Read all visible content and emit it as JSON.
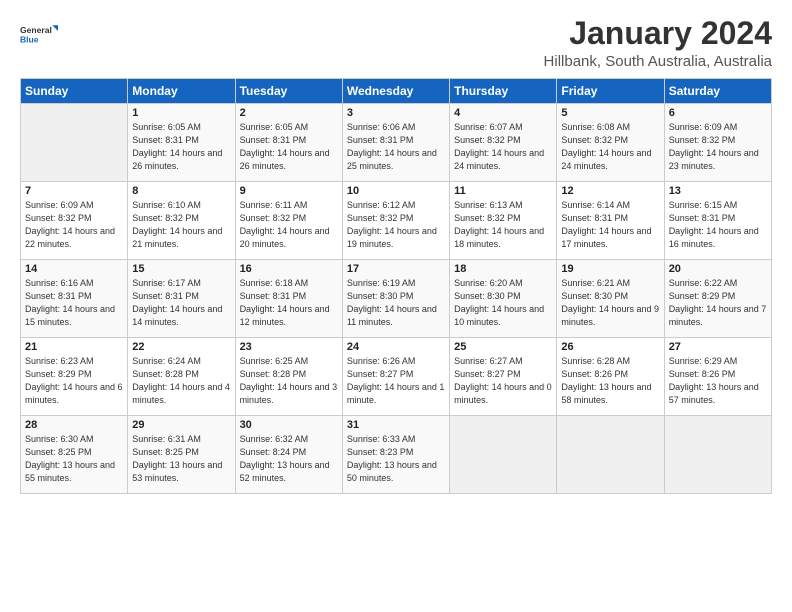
{
  "logo": {
    "line1": "General",
    "line2": "Blue"
  },
  "calendar": {
    "title": "January 2024",
    "subtitle": "Hillbank, South Australia, Australia"
  },
  "headers": [
    "Sunday",
    "Monday",
    "Tuesday",
    "Wednesday",
    "Thursday",
    "Friday",
    "Saturday"
  ],
  "weeks": [
    [
      {
        "day": "",
        "sunrise": "",
        "sunset": "",
        "daylight": ""
      },
      {
        "day": "1",
        "sunrise": "Sunrise: 6:05 AM",
        "sunset": "Sunset: 8:31 PM",
        "daylight": "Daylight: 14 hours and 26 minutes."
      },
      {
        "day": "2",
        "sunrise": "Sunrise: 6:05 AM",
        "sunset": "Sunset: 8:31 PM",
        "daylight": "Daylight: 14 hours and 26 minutes."
      },
      {
        "day": "3",
        "sunrise": "Sunrise: 6:06 AM",
        "sunset": "Sunset: 8:31 PM",
        "daylight": "Daylight: 14 hours and 25 minutes."
      },
      {
        "day": "4",
        "sunrise": "Sunrise: 6:07 AM",
        "sunset": "Sunset: 8:32 PM",
        "daylight": "Daylight: 14 hours and 24 minutes."
      },
      {
        "day": "5",
        "sunrise": "Sunrise: 6:08 AM",
        "sunset": "Sunset: 8:32 PM",
        "daylight": "Daylight: 14 hours and 24 minutes."
      },
      {
        "day": "6",
        "sunrise": "Sunrise: 6:09 AM",
        "sunset": "Sunset: 8:32 PM",
        "daylight": "Daylight: 14 hours and 23 minutes."
      }
    ],
    [
      {
        "day": "7",
        "sunrise": "Sunrise: 6:09 AM",
        "sunset": "Sunset: 8:32 PM",
        "daylight": "Daylight: 14 hours and 22 minutes."
      },
      {
        "day": "8",
        "sunrise": "Sunrise: 6:10 AM",
        "sunset": "Sunset: 8:32 PM",
        "daylight": "Daylight: 14 hours and 21 minutes."
      },
      {
        "day": "9",
        "sunrise": "Sunrise: 6:11 AM",
        "sunset": "Sunset: 8:32 PM",
        "daylight": "Daylight: 14 hours and 20 minutes."
      },
      {
        "day": "10",
        "sunrise": "Sunrise: 6:12 AM",
        "sunset": "Sunset: 8:32 PM",
        "daylight": "Daylight: 14 hours and 19 minutes."
      },
      {
        "day": "11",
        "sunrise": "Sunrise: 6:13 AM",
        "sunset": "Sunset: 8:32 PM",
        "daylight": "Daylight: 14 hours and 18 minutes."
      },
      {
        "day": "12",
        "sunrise": "Sunrise: 6:14 AM",
        "sunset": "Sunset: 8:31 PM",
        "daylight": "Daylight: 14 hours and 17 minutes."
      },
      {
        "day": "13",
        "sunrise": "Sunrise: 6:15 AM",
        "sunset": "Sunset: 8:31 PM",
        "daylight": "Daylight: 14 hours and 16 minutes."
      }
    ],
    [
      {
        "day": "14",
        "sunrise": "Sunrise: 6:16 AM",
        "sunset": "Sunset: 8:31 PM",
        "daylight": "Daylight: 14 hours and 15 minutes."
      },
      {
        "day": "15",
        "sunrise": "Sunrise: 6:17 AM",
        "sunset": "Sunset: 8:31 PM",
        "daylight": "Daylight: 14 hours and 14 minutes."
      },
      {
        "day": "16",
        "sunrise": "Sunrise: 6:18 AM",
        "sunset": "Sunset: 8:31 PM",
        "daylight": "Daylight: 14 hours and 12 minutes."
      },
      {
        "day": "17",
        "sunrise": "Sunrise: 6:19 AM",
        "sunset": "Sunset: 8:30 PM",
        "daylight": "Daylight: 14 hours and 11 minutes."
      },
      {
        "day": "18",
        "sunrise": "Sunrise: 6:20 AM",
        "sunset": "Sunset: 8:30 PM",
        "daylight": "Daylight: 14 hours and 10 minutes."
      },
      {
        "day": "19",
        "sunrise": "Sunrise: 6:21 AM",
        "sunset": "Sunset: 8:30 PM",
        "daylight": "Daylight: 14 hours and 9 minutes."
      },
      {
        "day": "20",
        "sunrise": "Sunrise: 6:22 AM",
        "sunset": "Sunset: 8:29 PM",
        "daylight": "Daylight: 14 hours and 7 minutes."
      }
    ],
    [
      {
        "day": "21",
        "sunrise": "Sunrise: 6:23 AM",
        "sunset": "Sunset: 8:29 PM",
        "daylight": "Daylight: 14 hours and 6 minutes."
      },
      {
        "day": "22",
        "sunrise": "Sunrise: 6:24 AM",
        "sunset": "Sunset: 8:28 PM",
        "daylight": "Daylight: 14 hours and 4 minutes."
      },
      {
        "day": "23",
        "sunrise": "Sunrise: 6:25 AM",
        "sunset": "Sunset: 8:28 PM",
        "daylight": "Daylight: 14 hours and 3 minutes."
      },
      {
        "day": "24",
        "sunrise": "Sunrise: 6:26 AM",
        "sunset": "Sunset: 8:27 PM",
        "daylight": "Daylight: 14 hours and 1 minute."
      },
      {
        "day": "25",
        "sunrise": "Sunrise: 6:27 AM",
        "sunset": "Sunset: 8:27 PM",
        "daylight": "Daylight: 14 hours and 0 minutes."
      },
      {
        "day": "26",
        "sunrise": "Sunrise: 6:28 AM",
        "sunset": "Sunset: 8:26 PM",
        "daylight": "Daylight: 13 hours and 58 minutes."
      },
      {
        "day": "27",
        "sunrise": "Sunrise: 6:29 AM",
        "sunset": "Sunset: 8:26 PM",
        "daylight": "Daylight: 13 hours and 57 minutes."
      }
    ],
    [
      {
        "day": "28",
        "sunrise": "Sunrise: 6:30 AM",
        "sunset": "Sunset: 8:25 PM",
        "daylight": "Daylight: 13 hours and 55 minutes."
      },
      {
        "day": "29",
        "sunrise": "Sunrise: 6:31 AM",
        "sunset": "Sunset: 8:25 PM",
        "daylight": "Daylight: 13 hours and 53 minutes."
      },
      {
        "day": "30",
        "sunrise": "Sunrise: 6:32 AM",
        "sunset": "Sunset: 8:24 PM",
        "daylight": "Daylight: 13 hours and 52 minutes."
      },
      {
        "day": "31",
        "sunrise": "Sunrise: 6:33 AM",
        "sunset": "Sunset: 8:23 PM",
        "daylight": "Daylight: 13 hours and 50 minutes."
      },
      {
        "day": "",
        "sunrise": "",
        "sunset": "",
        "daylight": ""
      },
      {
        "day": "",
        "sunrise": "",
        "sunset": "",
        "daylight": ""
      },
      {
        "day": "",
        "sunrise": "",
        "sunset": "",
        "daylight": ""
      }
    ]
  ]
}
